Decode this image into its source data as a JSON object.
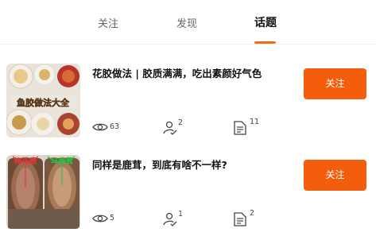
{
  "tabs": [
    {
      "label": "关注"
    },
    {
      "label": "发现"
    },
    {
      "label": "话题"
    }
  ],
  "active_tab": "话题",
  "accent_color": "#f26b1d",
  "topics": [
    {
      "title": "花胶做法 | 胶质满满，吃出素颜好气色",
      "thumbnail_caption": "鱼胶做法大全",
      "views": "63",
      "participants": "2",
      "posts": "11",
      "follow_label": "关注"
    },
    {
      "title": "同样是鹿茸，到底有啥不一样?",
      "thumbnail_labels": [
        "梅花鹿",
        "马鹿茸"
      ],
      "views": "5",
      "participants": "1",
      "posts": "2",
      "follow_label": "关注"
    }
  ]
}
